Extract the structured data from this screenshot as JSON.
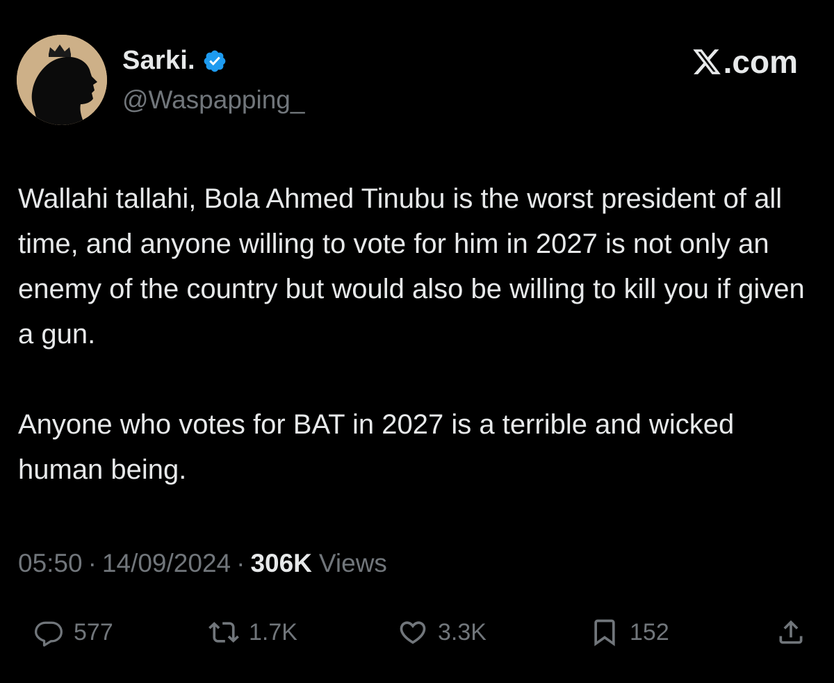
{
  "author": {
    "display_name": "Sarki.",
    "handle": "@Waspapping_",
    "verified": true,
    "avatar_icon": "silhouette-with-crown-avatar"
  },
  "brand": {
    "label": ".com",
    "icon": "x-logo-icon"
  },
  "tweet": {
    "paragraphs": [
      "Wallahi tallahi, Bola Ahmed Tinubu is the worst president of all time, and anyone willing to vote for him in 2027 is not only an enemy of the country but would also be willing to kill you if given a gun.",
      "Anyone who votes for BAT in 2027 is a terrible and wicked human being."
    ]
  },
  "meta": {
    "time": "05:50",
    "separator": "·",
    "date": "14/09/2024",
    "views_count": "306K",
    "views_label": "Views"
  },
  "actions": {
    "replies": "577",
    "reposts": "1.7K",
    "likes": "3.3K",
    "bookmarks": "152"
  },
  "colors": {
    "background": "#000000",
    "text": "#e7e9ea",
    "secondary": "#71767b",
    "verified": "#1d9bf0"
  }
}
